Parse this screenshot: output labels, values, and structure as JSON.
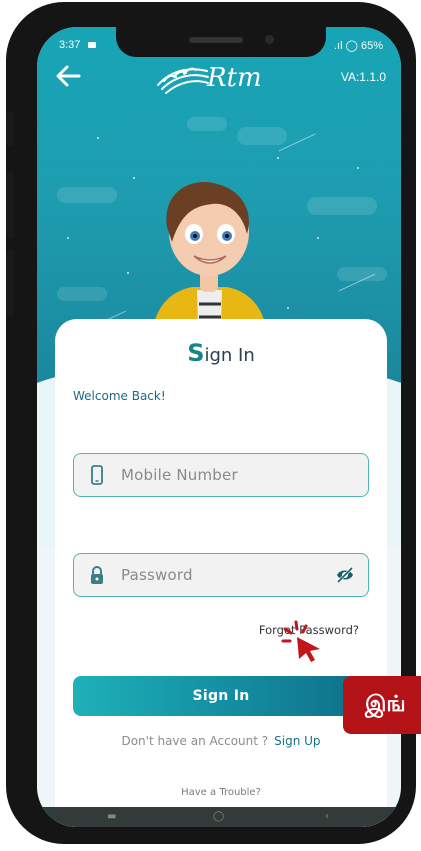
{
  "status_bar": {
    "time": "3:37",
    "right": ".ıl ◯ 65%"
  },
  "header": {
    "logo_text": "Rtm",
    "version": "VA:1.1.0"
  },
  "card": {
    "title_first": "S",
    "title_rest": "ign In",
    "welcome": "Welcome Back!"
  },
  "form": {
    "mobile_placeholder": "Mobile Number",
    "password_placeholder": "Password",
    "forgot_label": "Forgot Password?",
    "signin_label": "Sign In",
    "signup_question": "Don't have an Account ?",
    "signup_link": "Sign Up",
    "trouble_label": "Have a Trouble?"
  },
  "overlay": {
    "tag_text": "இங்"
  },
  "icons": {
    "back": "back-arrow-icon",
    "mobile": "mobile-phone-icon",
    "lock": "lock-icon",
    "eye": "eye-off-icon",
    "click": "click-pointer-icon"
  },
  "colors": {
    "primary_teal": "#1593a6",
    "header_teal": "#17a5b6",
    "tag_red": "#b31217",
    "link_blue": "#17708a"
  }
}
